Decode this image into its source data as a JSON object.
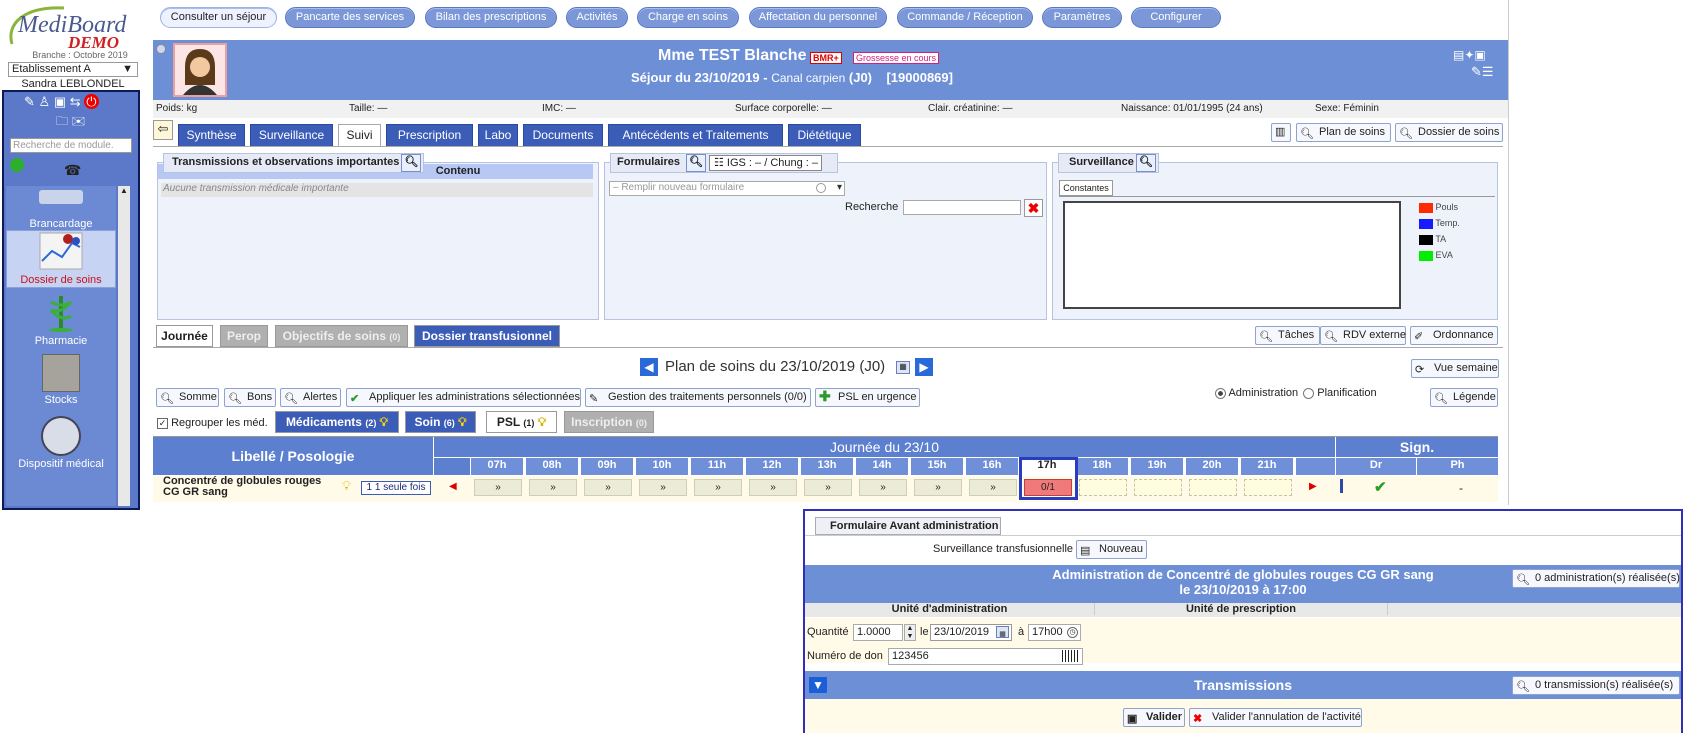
{
  "app": {
    "logo_text": "MediBoard",
    "logo_demo": "DEMO",
    "branch": "Branche : Octobre 2019",
    "establishment": "Etablissement A",
    "user": "Sandra LEBLONDEL",
    "search_placeholder": "Recherche de module."
  },
  "topnav": [
    "Consulter un séjour",
    "Pancarte des services",
    "Bilan des prescriptions",
    "Activités",
    "Charge en soins",
    "Affectation du personnel",
    "Commande / Réception",
    "Paramètres",
    "Configurer"
  ],
  "modules": [
    "Brancardage",
    "Dossier de soins",
    "Pharmacie",
    "Stocks",
    "Dispositif médical"
  ],
  "patient": {
    "name": "Mme TEST Blanche",
    "badge": "BMR+",
    "pregnancy": "Grossesse en cours",
    "sejour": "Séjour du 23/10/2019",
    "sep": "-",
    "service": "Canal carpien",
    "day": "(J0)",
    "nda": "[19000869]"
  },
  "info": {
    "poids": "Poids: kg",
    "taille": "Taille: —",
    "imc": "IMC: —",
    "surface": "Surface corporelle: —",
    "clairance": "Clair. créatinine: —",
    "naissance_label": "Naissance:",
    "naissance": "01/01/1995 (24 ans)",
    "sexe_label": "Sexe:",
    "sexe": "Féminin"
  },
  "tabs": [
    "Synthèse",
    "Surveillance",
    "Suivi",
    "Prescription",
    "Labo",
    "Documents",
    "Antécédents et Traitements",
    "Diététique"
  ],
  "tab_right": {
    "plan": "Plan de soins",
    "dossier": "Dossier de soins"
  },
  "transmissions": {
    "title": "Transmissions et observations importantes",
    "col": "Contenu",
    "empty": "Aucune transmission médicale importante"
  },
  "formulaires": {
    "title": "Formulaires",
    "igs": "IGS : – / Chung : –",
    "select": "– Remplir nouveau formulaire",
    "search": "Recherche"
  },
  "surveillance": {
    "title": "Surveillance",
    "tab": "Constantes",
    "legend": [
      {
        "label": "Pouls",
        "color": "#ff2a00"
      },
      {
        "label": "Temp.",
        "color": "#1a1aff"
      },
      {
        "label": "TA",
        "color": "#000000"
      },
      {
        "label": "EVA",
        "color": "#00ee00"
      }
    ]
  },
  "plan_tabs": [
    "Journée",
    "Perop",
    "Objectifs de soins",
    "(0)",
    "Dossier transfusionnel"
  ],
  "right_actions": [
    "Tâches",
    "RDV externe",
    "Ordonnance"
  ],
  "plan": {
    "title": "Plan de soins du 23/10/2019 (J0)",
    "vue": "Vue semaine",
    "mode1": "Administration",
    "mode2": "Planification",
    "legende": "Légende"
  },
  "toolbar": [
    "Somme",
    "Bons",
    "Alertes",
    "Appliquer les administrations sélectionnées",
    "Gestion des traitements personnels (0/0)",
    "PSL en urgence"
  ],
  "group": "Regrouper les méd.",
  "subtabs": [
    {
      "label": "Médicaments",
      "count": "(2)"
    },
    {
      "label": "Soin",
      "count": "(6)"
    },
    {
      "label": "PSL",
      "count": "(1)"
    },
    {
      "label": "Inscription",
      "count": "(0)"
    }
  ],
  "grid": {
    "libelle": "Libellé / Posologie",
    "journee": "Journée du 23/10",
    "sign": "Sign.",
    "dr": "Dr",
    "ph": "Ph",
    "hours": [
      "07h",
      "08h",
      "09h",
      "10h",
      "11h",
      "12h",
      "13h",
      "14h",
      "15h",
      "16h",
      "17h",
      "18h",
      "19h",
      "20h",
      "21h"
    ],
    "row_label1": "Concentré de globules rouges",
    "row_label2": "CG GR sang",
    "freq": "1 1 seule fois",
    "cell_filled": "»",
    "cell_active": "0/1",
    "ph_val": "-"
  },
  "popup": {
    "section": "Formulaire Avant administration",
    "surv": "Surveillance transfusionnelle",
    "nouveau": "Nouveau",
    "title1": "Administration de Concentré de globules rouges CG GR sang",
    "title2": "le 23/10/2019 à 17:00",
    "admin_btn": "0 administration(s) réalisée(s)",
    "unit_admin": "Unité d'administration",
    "unit_presc": "Unité de prescription",
    "qte_label": "Quantité",
    "qte": "1.0000",
    "le": "le",
    "date": "23/10/2019",
    "a": "à",
    "time": "17h00",
    "don_label": "Numéro de don",
    "don": "123456",
    "trans": "Transmissions",
    "trans_btn": "0 transmission(s) réalisée(s)",
    "valider": "Valider",
    "annuler": "Valider l'annulation de l'activité"
  }
}
